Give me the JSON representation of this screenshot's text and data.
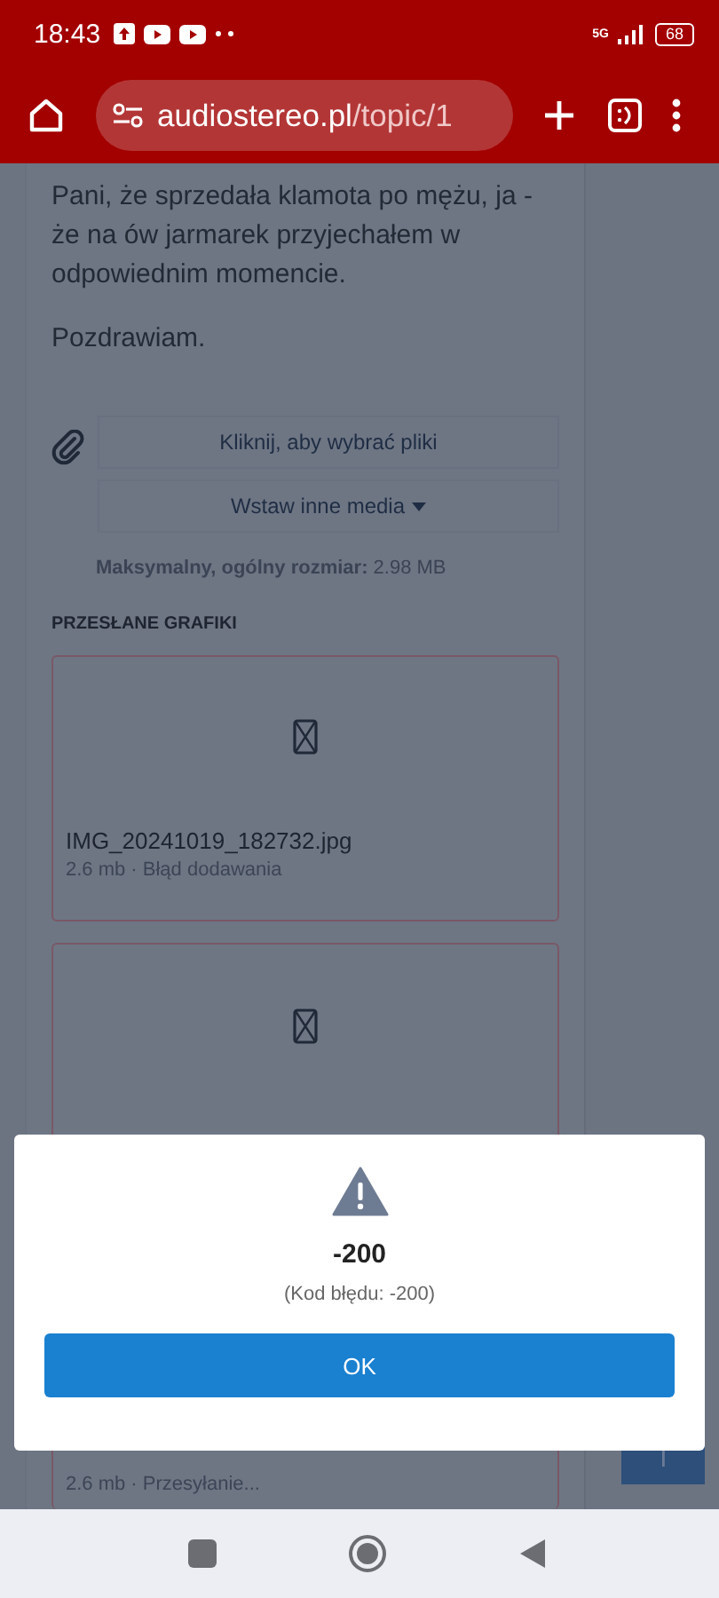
{
  "status_bar": {
    "time": "18:43",
    "network": "5G",
    "battery": "68"
  },
  "browser": {
    "url_host": "audiostereo.pl",
    "url_path": "/topic/1"
  },
  "post": {
    "lines": [
      "Pani, że sprzedała klamota po mężu, ja - że na ów jarmarek przyjechałem w odpowiednim momencie.",
      "Pozdrawiam."
    ]
  },
  "upload": {
    "choose_files": "Kliknij, aby wybrać pliki",
    "insert_media": "Wstaw inne media",
    "max_size": "**Maksymalny, ogólny rozmiar:** 2.98 MB",
    "heading": "PRZESŁANE GRAFIKI",
    "files": [
      {
        "name": "IMG_20241019_182732.jpg",
        "status": "2.6 mb · Błąd dodawania",
        "error": true
      },
      {
        "status": "2.6 mb · Przesyłanie...",
        "error": true
      }
    ]
  },
  "dialog": {
    "title": "-200",
    "message": "(Kod błędu: -200)",
    "button": "OK"
  }
}
